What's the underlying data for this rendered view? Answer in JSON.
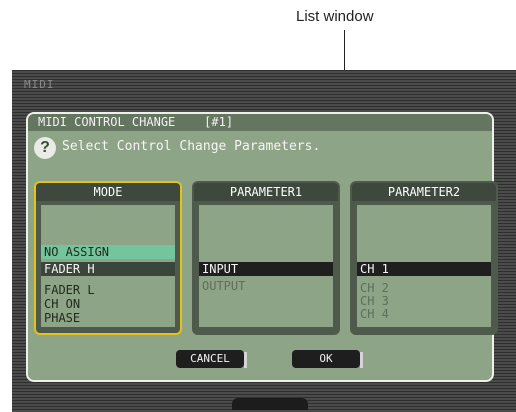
{
  "callout": {
    "label": "List window"
  },
  "screen": {
    "title": "MIDI",
    "bottom_tab": ""
  },
  "dialog": {
    "header": "MIDI CONTROL CHANGE    [#1]",
    "prompt": "Select Control Change Parameters.",
    "help_icon": "question-icon",
    "cancel_label": "CANCEL",
    "ok_label": "OK"
  },
  "lists": {
    "mode": {
      "title": "MODE",
      "items": [
        "NO ASSIGN",
        "FADER H",
        "FADER L",
        "CH ON",
        "PHASE"
      ],
      "selected": "FADER H"
    },
    "parameter1": {
      "title": "PARAMETER1",
      "items": [
        "INPUT",
        "OUTPUT"
      ],
      "selected": "INPUT"
    },
    "parameter2": {
      "title": "PARAMETER2",
      "items": [
        "CH 1",
        "CH 2",
        "CH 3",
        "CH 4"
      ],
      "selected": "CH 1"
    }
  },
  "colors": {
    "dialog_bg": "#8da487",
    "header_bg": "#647560",
    "active_border": "#e4c21a",
    "highlight_green": "#74c59f",
    "selected_row": "#1f1f1f"
  }
}
